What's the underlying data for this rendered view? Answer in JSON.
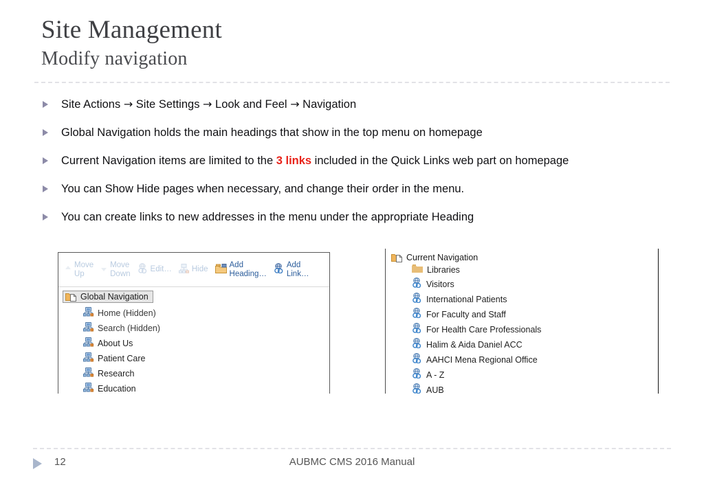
{
  "slide": {
    "title": "Site Management",
    "subtitle": "Modify navigation"
  },
  "bullets": [
    {
      "id": "bullet-breadcrumb-path",
      "segments": [
        {
          "text": "Site Actions ",
          "style": "normal"
        },
        {
          "text": "→",
          "style": "arrow"
        },
        {
          "text": " Site Settings ",
          "style": "normal"
        },
        {
          "text": "→",
          "style": "arrow"
        },
        {
          "text": " Look and Feel ",
          "style": "normal"
        },
        {
          "text": "→",
          "style": "arrow"
        },
        {
          "text": " Navigation",
          "style": "normal"
        }
      ]
    },
    {
      "id": "bullet-global-navigation",
      "segments": [
        {
          "text": "Global Navigation holds the main headings that show in the top menu on homepage",
          "style": "normal"
        }
      ]
    },
    {
      "id": "bullet-current-navigation",
      "segments": [
        {
          "text": "Current Navigation items are limited to the ",
          "style": "normal"
        },
        {
          "text": "3 links",
          "style": "accent-red"
        },
        {
          "text": " included in the Quick Links web part on homepage",
          "style": "normal"
        }
      ]
    },
    {
      "id": "bullet-show-hide",
      "segments": [
        {
          "text": "You can Show Hide pages when necessary,  and change their order in the menu.",
          "style": "normal"
        }
      ]
    },
    {
      "id": "bullet-create-links",
      "segments": [
        {
          "text": "You can create links to new addresses in the menu under the appropriate Heading",
          "style": "normal"
        }
      ]
    }
  ],
  "left_screenshot": {
    "name": "global-navigation-editor",
    "ribbon": [
      {
        "label_line1": "Move",
        "label_line2": "Up",
        "icon": "move-up-icon",
        "state": "disabled"
      },
      {
        "label_line1": "Move",
        "label_line2": "Down",
        "icon": "move-down-icon",
        "state": "disabled"
      },
      {
        "label_line1": "Edit…",
        "label_line2": "",
        "icon": "edit-link-icon",
        "state": "disabled"
      },
      {
        "label_line1": "Hide",
        "label_line2": "",
        "icon": "hide-node-icon",
        "state": "disabled"
      },
      {
        "label_line1": "Add",
        "label_line2": "Heading…",
        "icon": "add-heading-folder-icon",
        "state": "enabled"
      },
      {
        "label_line1": "Add",
        "label_line2": "Link…",
        "icon": "add-link-globe-icon",
        "state": "enabled"
      }
    ],
    "tree": {
      "root_label": "Global Navigation",
      "root_icon": "folder-page-icon",
      "root_selected": true,
      "items": [
        {
          "label": "Home (Hidden)",
          "icon": "sitemap-node-icon",
          "hidden": true
        },
        {
          "label": "Search (Hidden)",
          "icon": "sitemap-node-icon",
          "hidden": true
        },
        {
          "label": "About Us",
          "icon": "sitemap-node-icon",
          "hidden": false
        },
        {
          "label": "Patient Care",
          "icon": "sitemap-node-icon",
          "hidden": false
        },
        {
          "label": "Research",
          "icon": "sitemap-node-icon",
          "hidden": false
        },
        {
          "label": "Education",
          "icon": "sitemap-node-icon",
          "hidden": false
        }
      ]
    }
  },
  "right_screenshot": {
    "name": "current-navigation-editor",
    "tree": {
      "root_label": "Current Navigation",
      "root_icon": "folder-page-icon",
      "items": [
        {
          "label": "Libraries",
          "icon": "folder-icon"
        },
        {
          "label": "Visitors",
          "icon": "globe-link-icon"
        },
        {
          "label": "International Patients",
          "icon": "globe-link-icon"
        },
        {
          "label": "For Faculty and Staff",
          "icon": "globe-link-icon"
        },
        {
          "label": "For Health Care Professionals",
          "icon": "globe-link-icon"
        },
        {
          "label": "Halim & Aida Daniel ACC",
          "icon": "globe-link-icon"
        },
        {
          "label": "AAHCI Mena Regional Office",
          "icon": "globe-link-icon"
        },
        {
          "label": "A - Z",
          "icon": "globe-link-icon"
        },
        {
          "label": "AUB",
          "icon": "globe-link-icon"
        }
      ]
    }
  },
  "footer": {
    "page_number": "12",
    "center_text": "AUBMC CMS 2016 Manual",
    "marker_icon": "triangle-right-icon"
  },
  "colors": {
    "title": "#3f4044",
    "bullet_marker": "#8d8ba8",
    "accent_red": "#e8231a",
    "rule": "#e2e2e6",
    "ribbon_enabled": "#2c5d9b",
    "ribbon_disabled": "#b9cbe0",
    "footer_text": "#565656",
    "footer_marker": "#a9b6cc"
  }
}
